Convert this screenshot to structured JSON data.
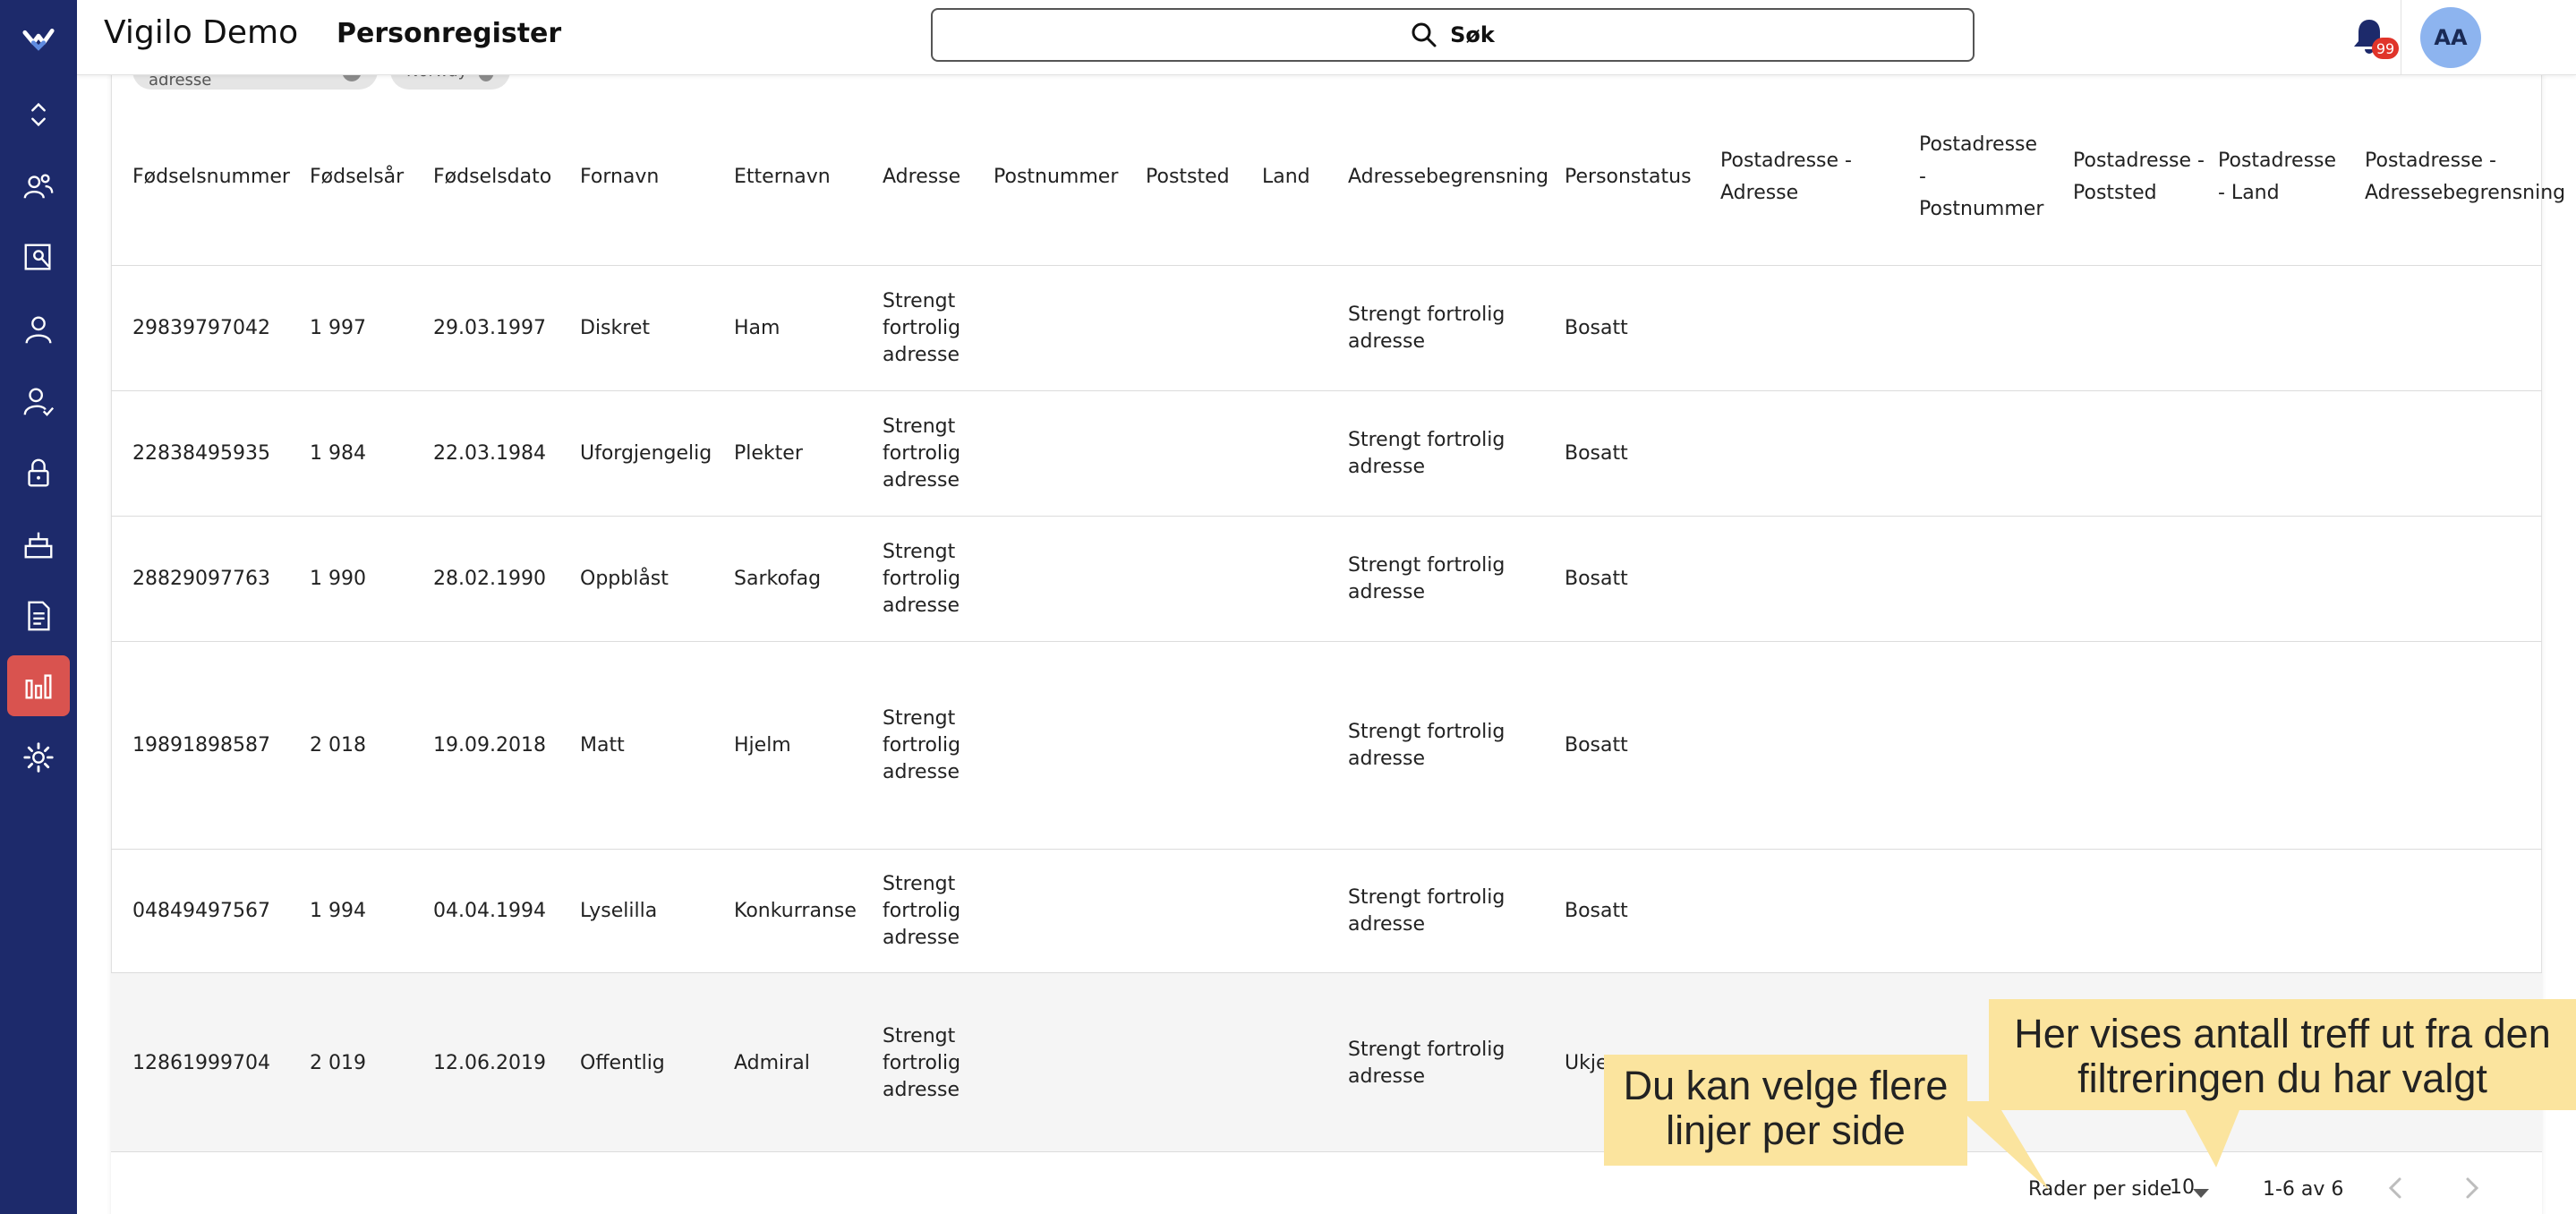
{
  "header": {
    "app_title": "Vigilo Demo",
    "page_title": "Personregister",
    "search_label": "Søk",
    "notification_count": "99",
    "avatar_initials": "AA"
  },
  "sidebar": {
    "items": [
      {
        "icon": "logo-icon"
      },
      {
        "icon": "expand-collapse-icon"
      },
      {
        "icon": "people-icon"
      },
      {
        "icon": "search-person-icon"
      },
      {
        "icon": "person-icon"
      },
      {
        "icon": "person-check-icon"
      },
      {
        "icon": "lock-icon"
      },
      {
        "icon": "cake-icon"
      },
      {
        "icon": "document-icon"
      },
      {
        "icon": "bar-chart-icon",
        "active": true
      },
      {
        "icon": "gear-icon"
      }
    ]
  },
  "filters": {
    "chips": [
      "Strengt fortrolig adresse",
      "Norway"
    ]
  },
  "table": {
    "columns": [
      {
        "label": "Fødselsnummer"
      },
      {
        "label": "Fødselsår"
      },
      {
        "label": "Fødselsdato"
      },
      {
        "label": "Fornavn"
      },
      {
        "label": "Etternavn"
      },
      {
        "label": "Adresse"
      },
      {
        "label": "Postnummer"
      },
      {
        "label": "Poststed"
      },
      {
        "label": "Land"
      },
      {
        "label": "Adressebegrensning"
      },
      {
        "label": "Personstatus"
      },
      {
        "label": "Postadresse - Adresse"
      },
      {
        "label": "Postadresse - Postnummer"
      },
      {
        "label": "Postadresse - Poststed"
      },
      {
        "label": "Postadresse - Land"
      },
      {
        "label": "Postadresse - Adressebegrensning"
      }
    ],
    "rows": [
      {
        "fnr": "29839797042",
        "year": "1 997",
        "date": "29.03.1997",
        "first": "Diskret",
        "last": "Ham",
        "address": "Strengt fortrolig adresse",
        "restriction": "Strengt fortrolig adresse",
        "status": "Bosatt"
      },
      {
        "fnr": "22838495935",
        "year": "1 984",
        "date": "22.03.1984",
        "first": "Uforgjengelig",
        "last": "Plekter",
        "address": "Strengt fortrolig adresse",
        "restriction": "Strengt fortrolig adresse",
        "status": "Bosatt"
      },
      {
        "fnr": "28829097763",
        "year": "1 990",
        "date": "28.02.1990",
        "first": "Oppblåst",
        "last": "Sarkofag",
        "address": "Strengt fortrolig adresse",
        "restriction": "Strengt fortrolig adresse",
        "status": "Bosatt"
      },
      {
        "fnr": "19891898587",
        "year": "2 018",
        "date": "19.09.2018",
        "first": "Matt",
        "last": "Hjelm",
        "address": "Strengt fortrolig adresse",
        "restriction": "Strengt fortrolig adresse",
        "status": "Bosatt"
      },
      {
        "fnr": "04849497567",
        "year": "1 994",
        "date": "04.04.1994",
        "first": "Lyselilla",
        "last": "Konkurranse",
        "address": "Strengt fortrolig adresse",
        "restriction": "Strengt fortrolig adresse",
        "status": "Bosatt"
      },
      {
        "fnr": "12861999704",
        "year": "2 019",
        "date": "12.06.2019",
        "first": "Offentlig",
        "last": "Admiral",
        "address": "Strengt fortrolig adresse",
        "restriction": "Strengt fortrolig adresse",
        "status": "Ukje"
      }
    ]
  },
  "pagination": {
    "rows_per_page_label": "Rader per side",
    "rows_per_page_value": "10",
    "range_text": "1-6 av 6"
  },
  "callouts": {
    "rows_per_page": "Du kan velge flere linjer per side",
    "hit_count": "Her vises antall treff ut fra den filtreringen du har valgt"
  },
  "colors": {
    "sidebar": "#1d2a6b",
    "active_item": "#d9534f",
    "callout": "#fbe49e",
    "badge": "#e0342a",
    "avatar": "#8db4ef"
  }
}
